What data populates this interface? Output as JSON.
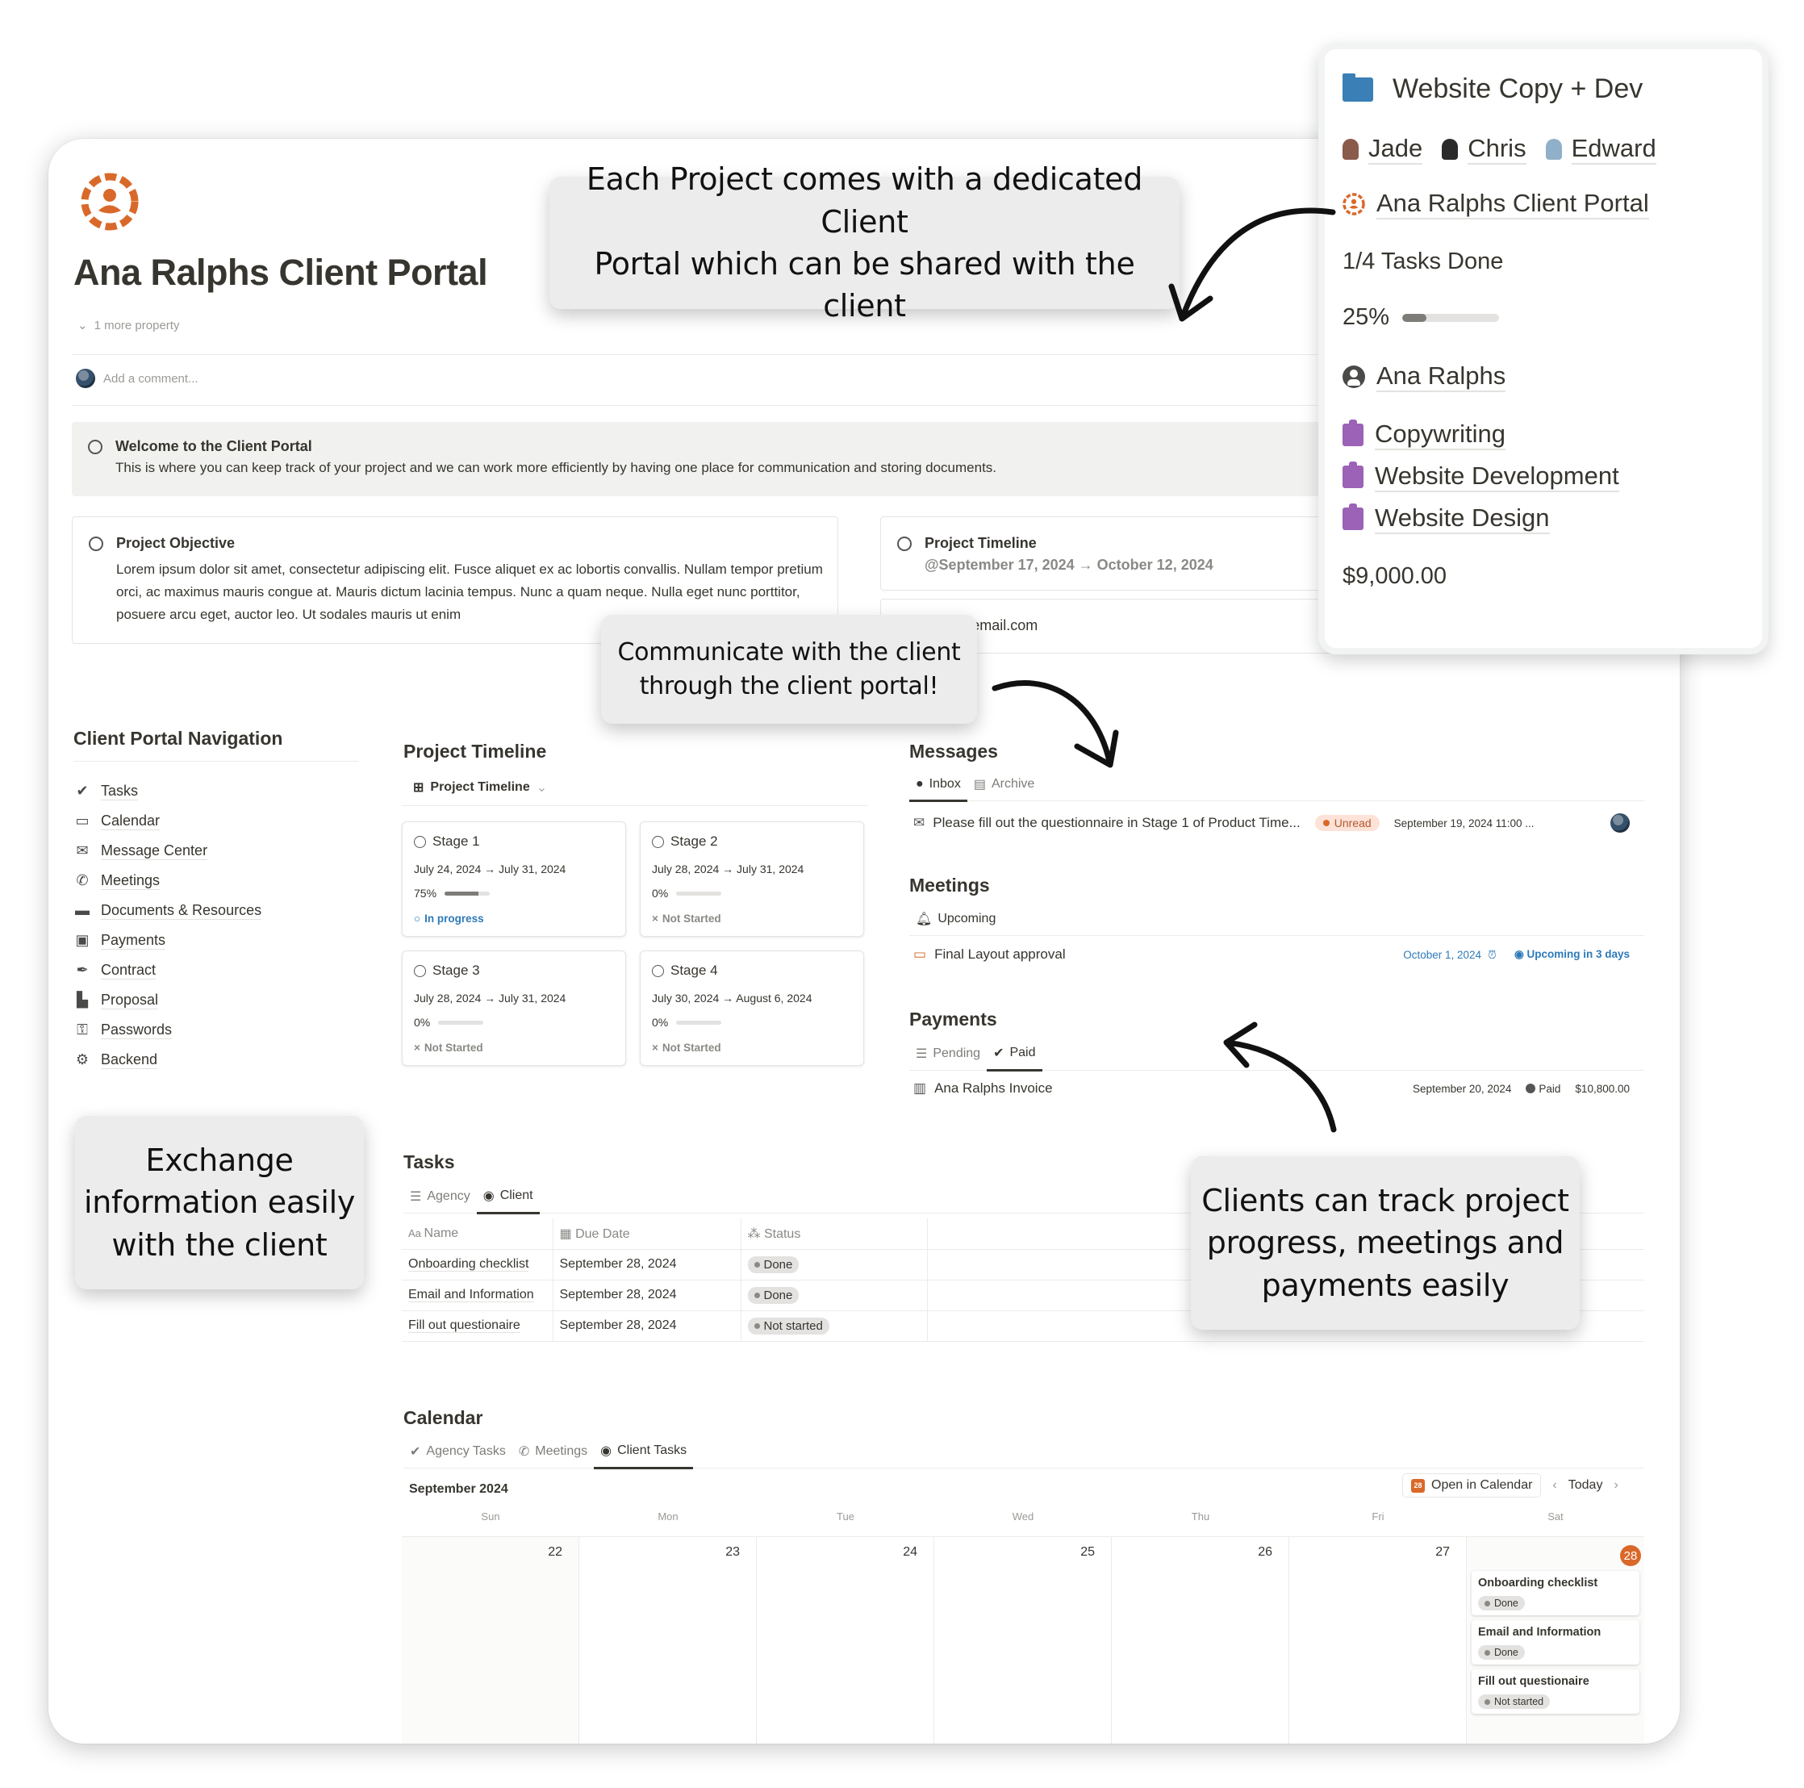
{
  "page": {
    "title": "Ana Ralphs Client Portal",
    "more_property": "1 more property",
    "comment_placeholder": "Add a comment..."
  },
  "welcome": {
    "title": "Welcome to the Client Portal",
    "text": "This is where you can keep track of your project and we can work more efficiently by having one place for communication and storing documents."
  },
  "objective": {
    "title": "Project Objective",
    "text": "Lorem ipsum dolor sit amet, consectetur adipiscing elit. Fusce aliquet ex ac lobortis convallis. Nullam tempor pretium orci, ac maximus mauris congue at. Mauris dictum lacinia tempus. Nunc a quam neque. Nulla eget nunc porttitor, posuere arcu eget, auctor leo. Ut sodales mauris ut enim"
  },
  "timeline_box": {
    "title": "Project Timeline",
    "dates": "@September 17, 2024 → October 12, 2024"
  },
  "contact": {
    "text": "t: xxx@email.com"
  },
  "navigation": {
    "title": "Client Portal Navigation",
    "items": [
      {
        "label": "Tasks",
        "icon": "check-circle-icon"
      },
      {
        "label": "Calendar",
        "icon": "calendar-icon"
      },
      {
        "label": "Message Center",
        "icon": "envelope-icon"
      },
      {
        "label": "Meetings",
        "icon": "phone-icon"
      },
      {
        "label": "Documents & Resources",
        "icon": "folder-icon"
      },
      {
        "label": "Payments",
        "icon": "money-icon"
      },
      {
        "label": "Contract",
        "icon": "pen-icon"
      },
      {
        "label": "Proposal",
        "icon": "document-icon"
      },
      {
        "label": "Passwords",
        "icon": "key-icon"
      },
      {
        "label": "Backend",
        "icon": "gear-icon"
      }
    ]
  },
  "project_timeline": {
    "title": "Project Timeline",
    "view_label": "Project Timeline",
    "stages": [
      {
        "name": "Stage 1",
        "dates": "July 24, 2024 → July 31, 2024",
        "progress_label": "75%",
        "progress": 0.75,
        "status": "In progress"
      },
      {
        "name": "Stage 2",
        "dates": "July 28, 2024 → July 31, 2024",
        "progress_label": "0%",
        "progress": 0,
        "status": "Not Started"
      },
      {
        "name": "Stage 3",
        "dates": "July 28, 2024 → July 31, 2024",
        "progress_label": "0%",
        "progress": 0,
        "status": "Not Started"
      },
      {
        "name": "Stage 4",
        "dates": "July 30, 2024 → August 6, 2024",
        "progress_label": "0%",
        "progress": 0,
        "status": "Not Started"
      }
    ]
  },
  "messages": {
    "title": "Messages",
    "tabs": [
      "Inbox",
      "Archive"
    ],
    "items": [
      {
        "subject": "Please fill out the questionnaire in Stage 1 of Product Time...",
        "status": "Unread",
        "date": "September 19, 2024 11:00 ..."
      }
    ]
  },
  "meetings": {
    "title": "Meetings",
    "tabs": [
      "Upcoming"
    ],
    "items": [
      {
        "name": "Final Layout approval",
        "date": "October 1, 2024",
        "status": "Upcoming in 3 days"
      }
    ]
  },
  "payments": {
    "title": "Payments",
    "tabs": [
      "Pending",
      "Paid"
    ],
    "items": [
      {
        "name": "Ana Ralphs Invoice",
        "date": "September 20, 2024",
        "status": "Paid",
        "amount": "$10,800.00"
      }
    ]
  },
  "tasks": {
    "title": "Tasks",
    "tabs": [
      "Agency",
      "Client"
    ],
    "columns": [
      "Name",
      "Due Date",
      "Status"
    ],
    "rows": [
      {
        "name": "Onboarding checklist",
        "due": "September 28, 2024",
        "status": "Done"
      },
      {
        "name": "Email and Information",
        "due": "September 28, 2024",
        "status": "Done"
      },
      {
        "name": "Fill out questionaire",
        "due": "September 28, 2024",
        "status": "Not started"
      }
    ]
  },
  "calendar": {
    "title": "Calendar",
    "tabs": [
      "Agency Tasks",
      "Meetings",
      "Client Tasks"
    ],
    "month": "September 2024",
    "open_label": "Open in Calendar",
    "mini_icon_day": "28",
    "today_label": "Today",
    "weekdays": [
      "Sun",
      "Mon",
      "Tue",
      "Wed",
      "Thu",
      "Fri",
      "Sat"
    ],
    "days": [
      "22",
      "23",
      "24",
      "25",
      "26",
      "27",
      "28"
    ],
    "events": [
      {
        "title": "Onboarding checklist",
        "status": "Done"
      },
      {
        "title": "Email and Information",
        "status": "Done"
      },
      {
        "title": "Fill out questionaire",
        "status": "Not started"
      }
    ]
  },
  "project_card": {
    "title": "Website Copy + Dev",
    "team": [
      "Jade",
      "Chris",
      "Edward"
    ],
    "portal_link": "Ana Ralphs Client Portal",
    "tasks_done": "1/4 Tasks Done",
    "progress_label": "25%",
    "progress": 0.25,
    "client": "Ana Ralphs",
    "services": [
      "Copywriting",
      "Website Development",
      "Website Design"
    ],
    "budget": "$9,000.00"
  },
  "callouts": {
    "portal": [
      "Each Project comes with a dedicated Client",
      "Portal which can be shared with the client"
    ],
    "communicate": [
      "Communicate with the client",
      "through the client portal!"
    ],
    "exchange": [
      "Exchange",
      "information easily",
      "with the client"
    ],
    "track": [
      "Clients can track project",
      "progress, meetings and",
      "payments easily"
    ]
  },
  "colors": {
    "accent_orange": "#d9692a",
    "folder_blue": "#3a7fb5",
    "service_purple": "#9b62b8",
    "link_blue": "#2e7ab8",
    "unread_bg": "#fde2d7"
  }
}
